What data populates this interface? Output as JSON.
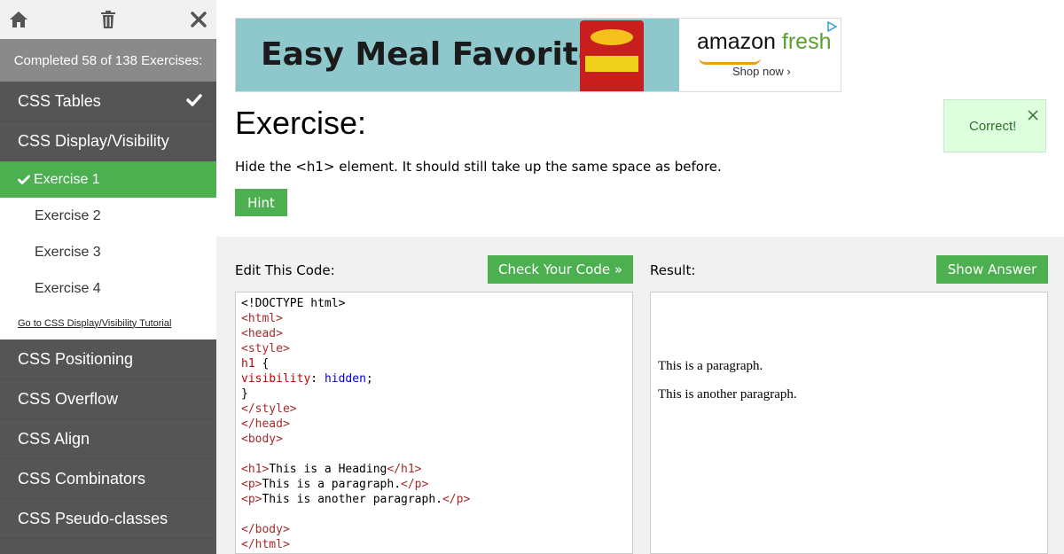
{
  "sidebar": {
    "progress_text": "Completed 58 of 138 Exercises:",
    "items_top": [
      {
        "label": "CSS Tables",
        "completed": true
      },
      {
        "label": "CSS Display/Visibility",
        "completed": false
      }
    ],
    "sub_items": [
      {
        "label": "Exercise 1",
        "active": true
      },
      {
        "label": "Exercise 2",
        "active": false
      },
      {
        "label": "Exercise 3",
        "active": false
      },
      {
        "label": "Exercise 4",
        "active": false
      }
    ],
    "tutorial_link": "Go to CSS Display/Visibility Tutorial",
    "items_bottom": [
      {
        "label": "CSS Positioning"
      },
      {
        "label": "CSS Overflow"
      },
      {
        "label": "CSS Align"
      },
      {
        "label": "CSS Combinators"
      },
      {
        "label": "CSS Pseudo-classes"
      }
    ]
  },
  "ad": {
    "headline": "Easy Meal Favorites",
    "brand_word1": "amazon",
    "brand_word2": "fresh",
    "cta": "Shop now ›"
  },
  "exercise": {
    "title": "Exercise:",
    "instruction": "Hide the <h1> element. It should still take up the same space as before.",
    "hint_label": "Hint",
    "feedback": "Correct!"
  },
  "editor": {
    "label": "Edit This Code:",
    "check_label": "Check Your Code »",
    "code_lines": [
      [
        {
          "c": "",
          "t": "<!DOCTYPE html>"
        }
      ],
      [
        {
          "c": "t",
          "t": "<html>"
        }
      ],
      [
        {
          "c": "t",
          "t": "<head>"
        }
      ],
      [
        {
          "c": "t",
          "t": "<style>"
        }
      ],
      [
        {
          "c": "s",
          "t": "h1"
        },
        {
          "c": "",
          "t": " {"
        }
      ],
      [
        {
          "c": "k",
          "t": "visibility"
        },
        {
          "c": "",
          "t": ": "
        },
        {
          "c": "v",
          "t": "hidden"
        },
        {
          "c": "",
          "t": ";"
        }
      ],
      [
        {
          "c": "",
          "t": "}"
        }
      ],
      [
        {
          "c": "t",
          "t": "</style>"
        }
      ],
      [
        {
          "c": "t",
          "t": "</head>"
        }
      ],
      [
        {
          "c": "t",
          "t": "<body>"
        }
      ],
      [
        {
          "c": "",
          "t": ""
        }
      ],
      [
        {
          "c": "t",
          "t": "<h1>"
        },
        {
          "c": "",
          "t": "This is a Heading"
        },
        {
          "c": "t",
          "t": "</h1>"
        }
      ],
      [
        {
          "c": "t",
          "t": "<p>"
        },
        {
          "c": "",
          "t": "This is a paragraph."
        },
        {
          "c": "t",
          "t": "</p>"
        }
      ],
      [
        {
          "c": "t",
          "t": "<p>"
        },
        {
          "c": "",
          "t": "This is another paragraph."
        },
        {
          "c": "t",
          "t": "</p>"
        }
      ],
      [
        {
          "c": "",
          "t": ""
        }
      ],
      [
        {
          "c": "t",
          "t": "</body>"
        }
      ],
      [
        {
          "c": "t",
          "t": "</html>"
        }
      ]
    ]
  },
  "result": {
    "label": "Result:",
    "show_answer_label": "Show Answer",
    "paragraph1": "This is a paragraph.",
    "paragraph2": "This is another paragraph."
  },
  "icons": {
    "home": "home-icon",
    "trash": "trash-icon",
    "close": "close-icon",
    "check": "check-icon"
  },
  "colors": {
    "accent_green": "#4caf50",
    "sidebar_bg": "#555555",
    "progress_bg": "#8a8a8a",
    "correct_bg": "#ddffdd"
  }
}
